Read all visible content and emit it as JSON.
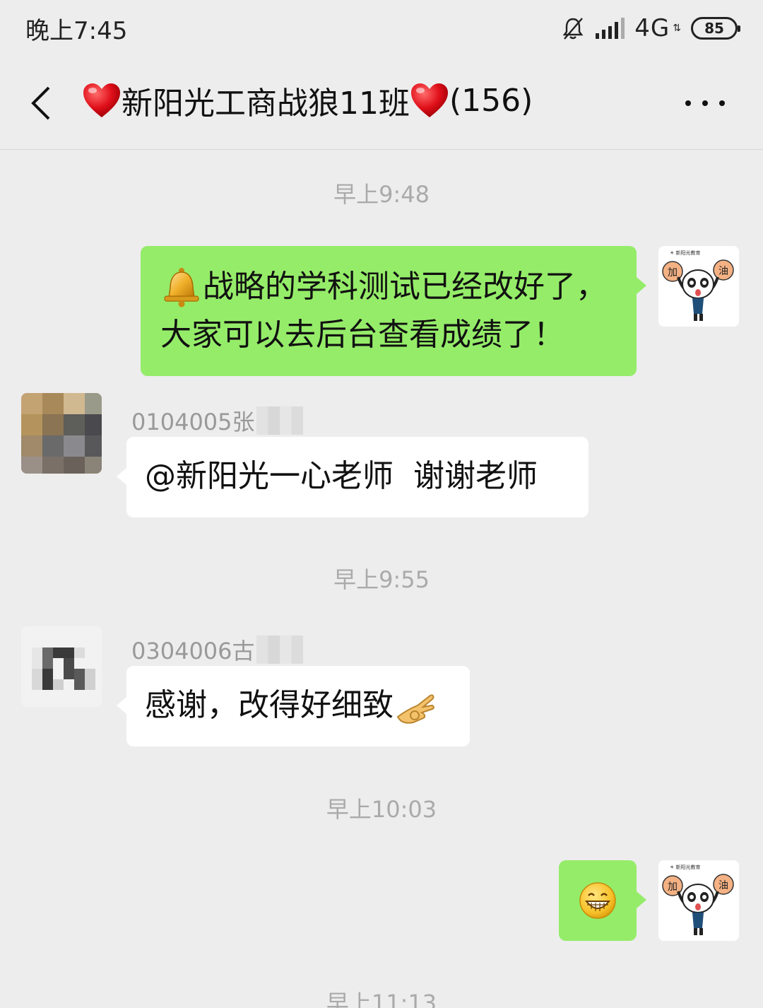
{
  "status_bar": {
    "time": "晚上7:45",
    "network": "4G",
    "battery": "85"
  },
  "nav": {
    "title": "新阳光工商战狼11班",
    "member_count": "(156)"
  },
  "messages": [
    {
      "type": "timestamp",
      "text": "早上9:48"
    },
    {
      "type": "outgoing",
      "line1": "战略的学科测试已经改好了，",
      "line2": "大家可以去后台查看成绩了！"
    },
    {
      "type": "incoming",
      "sender": "0104005张",
      "text": "@新阳光一心老师  谢谢老师"
    },
    {
      "type": "timestamp",
      "text": "早上9:55"
    },
    {
      "type": "incoming",
      "sender": "0304006古",
      "text": "感谢，改得好细致"
    },
    {
      "type": "timestamp",
      "text": "早上10:03"
    },
    {
      "type": "outgoing-emoji",
      "emoji": "grin-emoji"
    },
    {
      "type": "timestamp",
      "text": "早上11:13"
    }
  ],
  "sticker_text": {
    "left": "加",
    "right": "油"
  },
  "colors": {
    "background": "#ededed",
    "outgoing_bubble": "#95ec69",
    "incoming_bubble": "#ffffff",
    "timestamp": "#aaaaaa"
  }
}
